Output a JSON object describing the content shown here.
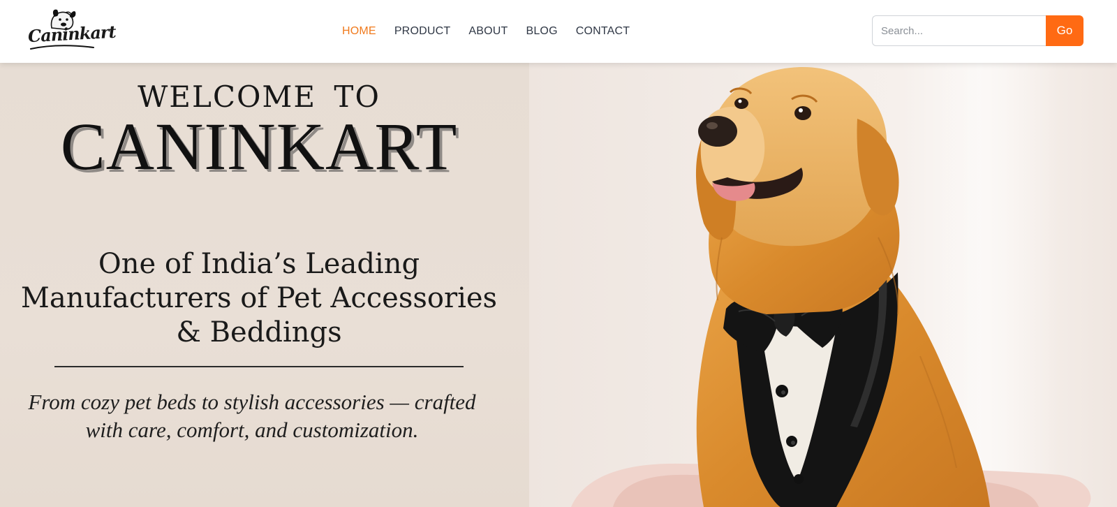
{
  "header": {
    "logo_text": "Caninkart",
    "nav": [
      {
        "label": "HOME",
        "active": true
      },
      {
        "label": "PRODUCT",
        "active": false
      },
      {
        "label": "ABOUT",
        "active": false
      },
      {
        "label": "BLOG",
        "active": false
      },
      {
        "label": "CONTACT",
        "active": false
      }
    ],
    "search": {
      "placeholder": "Search...",
      "value": "",
      "button_label": "Go"
    }
  },
  "hero": {
    "welcome": "WELCOME TO",
    "brand": "CANINKART",
    "tagline": "One of India’s Leading Manufacturers of Pet Accessories & Beddings",
    "subtext": "From cozy pet beds to stylish accessories — crafted with care, comfort, and customization.",
    "image": "golden-retriever-in-tuxedo-photo"
  },
  "colors": {
    "accent": "#ff6a13",
    "nav_active": "#f07a1d",
    "nav_text": "#2f3745",
    "hero_bg": "#e8ded5"
  }
}
